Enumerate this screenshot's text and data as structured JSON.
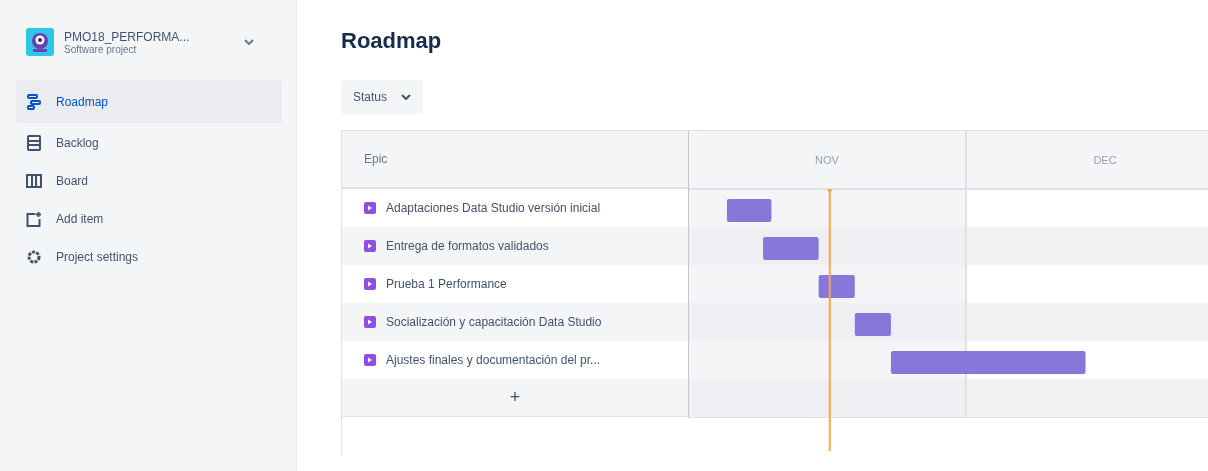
{
  "sidebar": {
    "project": {
      "name": "PMO18_PERFORMA...",
      "type": "Software project"
    },
    "items": [
      {
        "label": "Roadmap",
        "kind": "roadmap",
        "selected": true
      },
      {
        "label": "Backlog",
        "kind": "backlog",
        "selected": false
      },
      {
        "label": "Board",
        "kind": "board",
        "selected": false
      },
      {
        "label": "Add item",
        "kind": "add",
        "selected": false
      },
      {
        "label": "Project settings",
        "kind": "settings",
        "selected": false
      }
    ]
  },
  "page": {
    "title": "Roadmap",
    "filter": "Status"
  },
  "table": {
    "epic_header": "Epic",
    "epics": [
      {
        "name": "Adaptaciones Data Studio versión inicial"
      },
      {
        "name": "Entrega de formatos validados"
      },
      {
        "name": "Prueba 1 Performance"
      },
      {
        "name": "Socialización y capacitación Data Studio"
      },
      {
        "name": "Ajustes finales y documentación del pr..."
      }
    ],
    "add_label": "+",
    "months": [
      {
        "label": "NOV"
      },
      {
        "label": "DEC"
      }
    ]
  }
}
